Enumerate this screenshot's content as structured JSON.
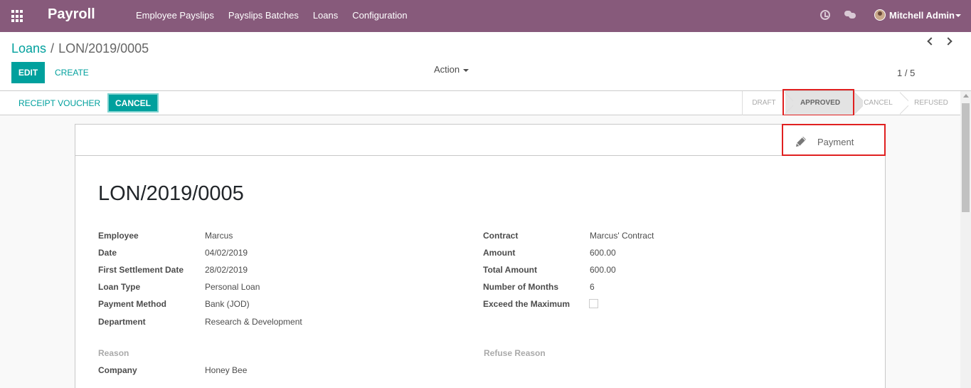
{
  "navbar": {
    "brand": "Payroll",
    "menu": [
      "Employee Payslips",
      "Payslips Batches",
      "Loans",
      "Configuration"
    ],
    "user": "Mitchell Admin",
    "icons": [
      "apps-icon",
      "clock-icon",
      "chat-icon"
    ]
  },
  "breadcrumb": {
    "parent": "Loans",
    "separator": "/",
    "current": "LON/2019/0005"
  },
  "toolbar": {
    "edit_label": "EDIT",
    "create_label": "CREATE",
    "action_label": "Action"
  },
  "pager": {
    "text": "1 / 5"
  },
  "statusbar": {
    "receipt_label": "RECEIPT VOUCHER",
    "cancel_label": "CANCEL",
    "stages": [
      "DRAFT",
      "APPROVED",
      "CANCEL",
      "REFUSED"
    ],
    "active_stage": "APPROVED"
  },
  "button_box": {
    "payment_label": "Payment"
  },
  "record": {
    "title": "LON/2019/0005",
    "left": [
      {
        "label": "Employee",
        "value": "Marcus"
      },
      {
        "label": "Date",
        "value": "04/02/2019"
      },
      {
        "label": "First Settlement Date",
        "value": "28/02/2019"
      },
      {
        "label": "Loan Type",
        "value": "Personal Loan"
      },
      {
        "label": "Payment Method",
        "value": "Bank (JOD)"
      },
      {
        "label": "Department",
        "value": "Research & Development"
      }
    ],
    "right": [
      {
        "label": "Contract",
        "value": "Marcus' Contract"
      },
      {
        "label": "Amount",
        "value": "600.00"
      },
      {
        "label": "Total Amount",
        "value": "600.00"
      },
      {
        "label": "Number of Months",
        "value": "6"
      },
      {
        "label": "Exceed the Maximum",
        "value": ""
      }
    ],
    "reason_label": "Reason",
    "refuse_reason_label": "Refuse Reason",
    "company_label": "Company",
    "company_value": "Honey Bee"
  },
  "colors": {
    "navbar": "#875a7b",
    "primary": "#00a09d",
    "highlight": "#e02020"
  }
}
